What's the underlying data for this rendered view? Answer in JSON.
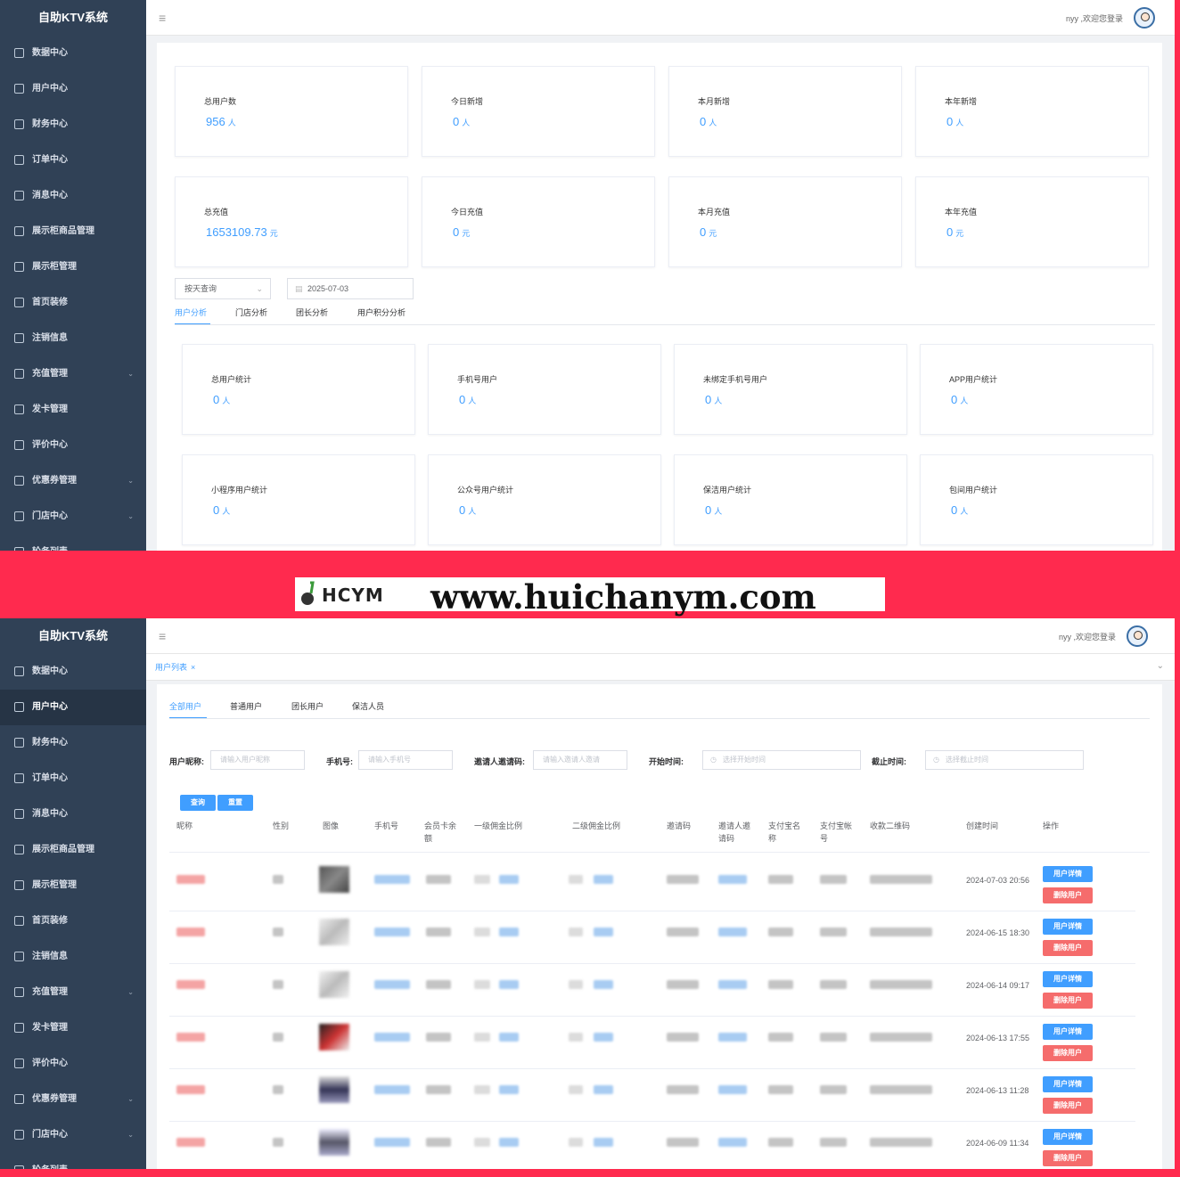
{
  "app": {
    "title": "自助KTV系统",
    "welcome": "nyy ,欢迎您登录",
    "hamburger": "≡"
  },
  "colors": {
    "sidebar": "#304156",
    "accent": "#409eff",
    "danger": "#f56c6c",
    "border": "#ff2a4e"
  },
  "sidebar_top": [
    {
      "label": "数据中心",
      "icon": "monitor-icon",
      "arrow": ""
    },
    {
      "label": "用户中心",
      "icon": "user-icon",
      "arrow": ""
    },
    {
      "label": "财务中心",
      "icon": "money-icon",
      "arrow": ""
    },
    {
      "label": "订单中心",
      "icon": "order-icon",
      "arrow": ""
    },
    {
      "label": "消息中心",
      "icon": "message-icon",
      "arrow": ""
    },
    {
      "label": "展示柜商品管理",
      "icon": "box-icon",
      "arrow": ""
    },
    {
      "label": "展示柜管理",
      "icon": "cabinet-icon",
      "arrow": ""
    },
    {
      "label": "首页装修",
      "icon": "home-decor-icon",
      "arrow": ""
    },
    {
      "label": "注销信息",
      "icon": "logout-icon",
      "arrow": ""
    },
    {
      "label": "充值管理",
      "icon": "recharge-icon",
      "arrow": "⌄"
    },
    {
      "label": "发卡管理",
      "icon": "card-icon",
      "arrow": ""
    },
    {
      "label": "评价中心",
      "icon": "comment-icon",
      "arrow": ""
    },
    {
      "label": "优惠券管理",
      "icon": "coupon-icon",
      "arrow": "⌄"
    },
    {
      "label": "门店中心",
      "icon": "store-icon",
      "arrow": "⌄"
    },
    {
      "label": "轮务列表",
      "icon": "list-icon",
      "arrow": ""
    }
  ],
  "dashboard": {
    "row1": [
      {
        "label": "总用户数",
        "value": "956",
        "unit": "人"
      },
      {
        "label": "今日新增",
        "value": "0",
        "unit": "人"
      },
      {
        "label": "本月新增",
        "value": "0",
        "unit": "人"
      },
      {
        "label": "本年新增",
        "value": "0",
        "unit": "人"
      }
    ],
    "row2": [
      {
        "label": "总充值",
        "value": "1653109.73",
        "unit": "元"
      },
      {
        "label": "今日充值",
        "value": "0",
        "unit": "元"
      },
      {
        "label": "本月充值",
        "value": "0",
        "unit": "元"
      },
      {
        "label": "本年充值",
        "value": "0",
        "unit": "元"
      }
    ],
    "filter_select": "按天查询",
    "date_value": "2025-07-03",
    "tabs": [
      "用户分析",
      "门店分析",
      "团长分析",
      "用户积分分析"
    ],
    "row3": [
      {
        "label": "总用户统计",
        "value": "0",
        "unit": "人"
      },
      {
        "label": "手机号用户",
        "value": "0",
        "unit": "人"
      },
      {
        "label": "未绑定手机号用户",
        "value": "0",
        "unit": "人"
      },
      {
        "label": "APP用户统计",
        "value": "0",
        "unit": "人"
      }
    ],
    "row4": [
      {
        "label": "小程序用户统计",
        "value": "0",
        "unit": "人"
      },
      {
        "label": "公众号用户统计",
        "value": "0",
        "unit": "人"
      },
      {
        "label": "保洁用户统计",
        "value": "0",
        "unit": "人"
      },
      {
        "label": "包间用户统计",
        "value": "0",
        "unit": "人"
      }
    ]
  },
  "watermark": {
    "logo": "HCYM",
    "url": "www.huichanym.com"
  },
  "user_list": {
    "tag": "用户列表",
    "tag_close": "×",
    "tabs": [
      "全部用户",
      "普通用户",
      "团长用户",
      "保洁人员"
    ],
    "filters": [
      {
        "label": "用户昵称:",
        "placeholder": "请输入用户昵称"
      },
      {
        "label": "手机号:",
        "placeholder": "请输入手机号"
      },
      {
        "label": "邀请人邀请码:",
        "placeholder": "请输入邀请人邀请"
      },
      {
        "label": "开始时间:",
        "placeholder": "选择开始时间"
      },
      {
        "label": "截止时间:",
        "placeholder": "选择截止时间"
      }
    ],
    "search_btn": "查询",
    "reset_btn": "重置",
    "columns": [
      "昵称",
      "性别",
      "图像",
      "手机号",
      "会员卡余额",
      "一级佣金比例",
      "二级佣金比例",
      "邀请码",
      "邀请人邀请码",
      "支付宝名称",
      "支付宝帐号",
      "收款二维码",
      "创建时间",
      "操作"
    ],
    "rows": [
      {
        "created": "2024-07-03 20:56"
      },
      {
        "created": "2024-06-15 18:30"
      },
      {
        "created": "2024-06-14 09:17"
      },
      {
        "created": "2024-06-13 17:55"
      },
      {
        "created": "2024-06-13 11:28"
      },
      {
        "created": "2024-06-09 11:34"
      }
    ],
    "detail_btn": "用户详情",
    "delete_btn": "删除用户"
  }
}
